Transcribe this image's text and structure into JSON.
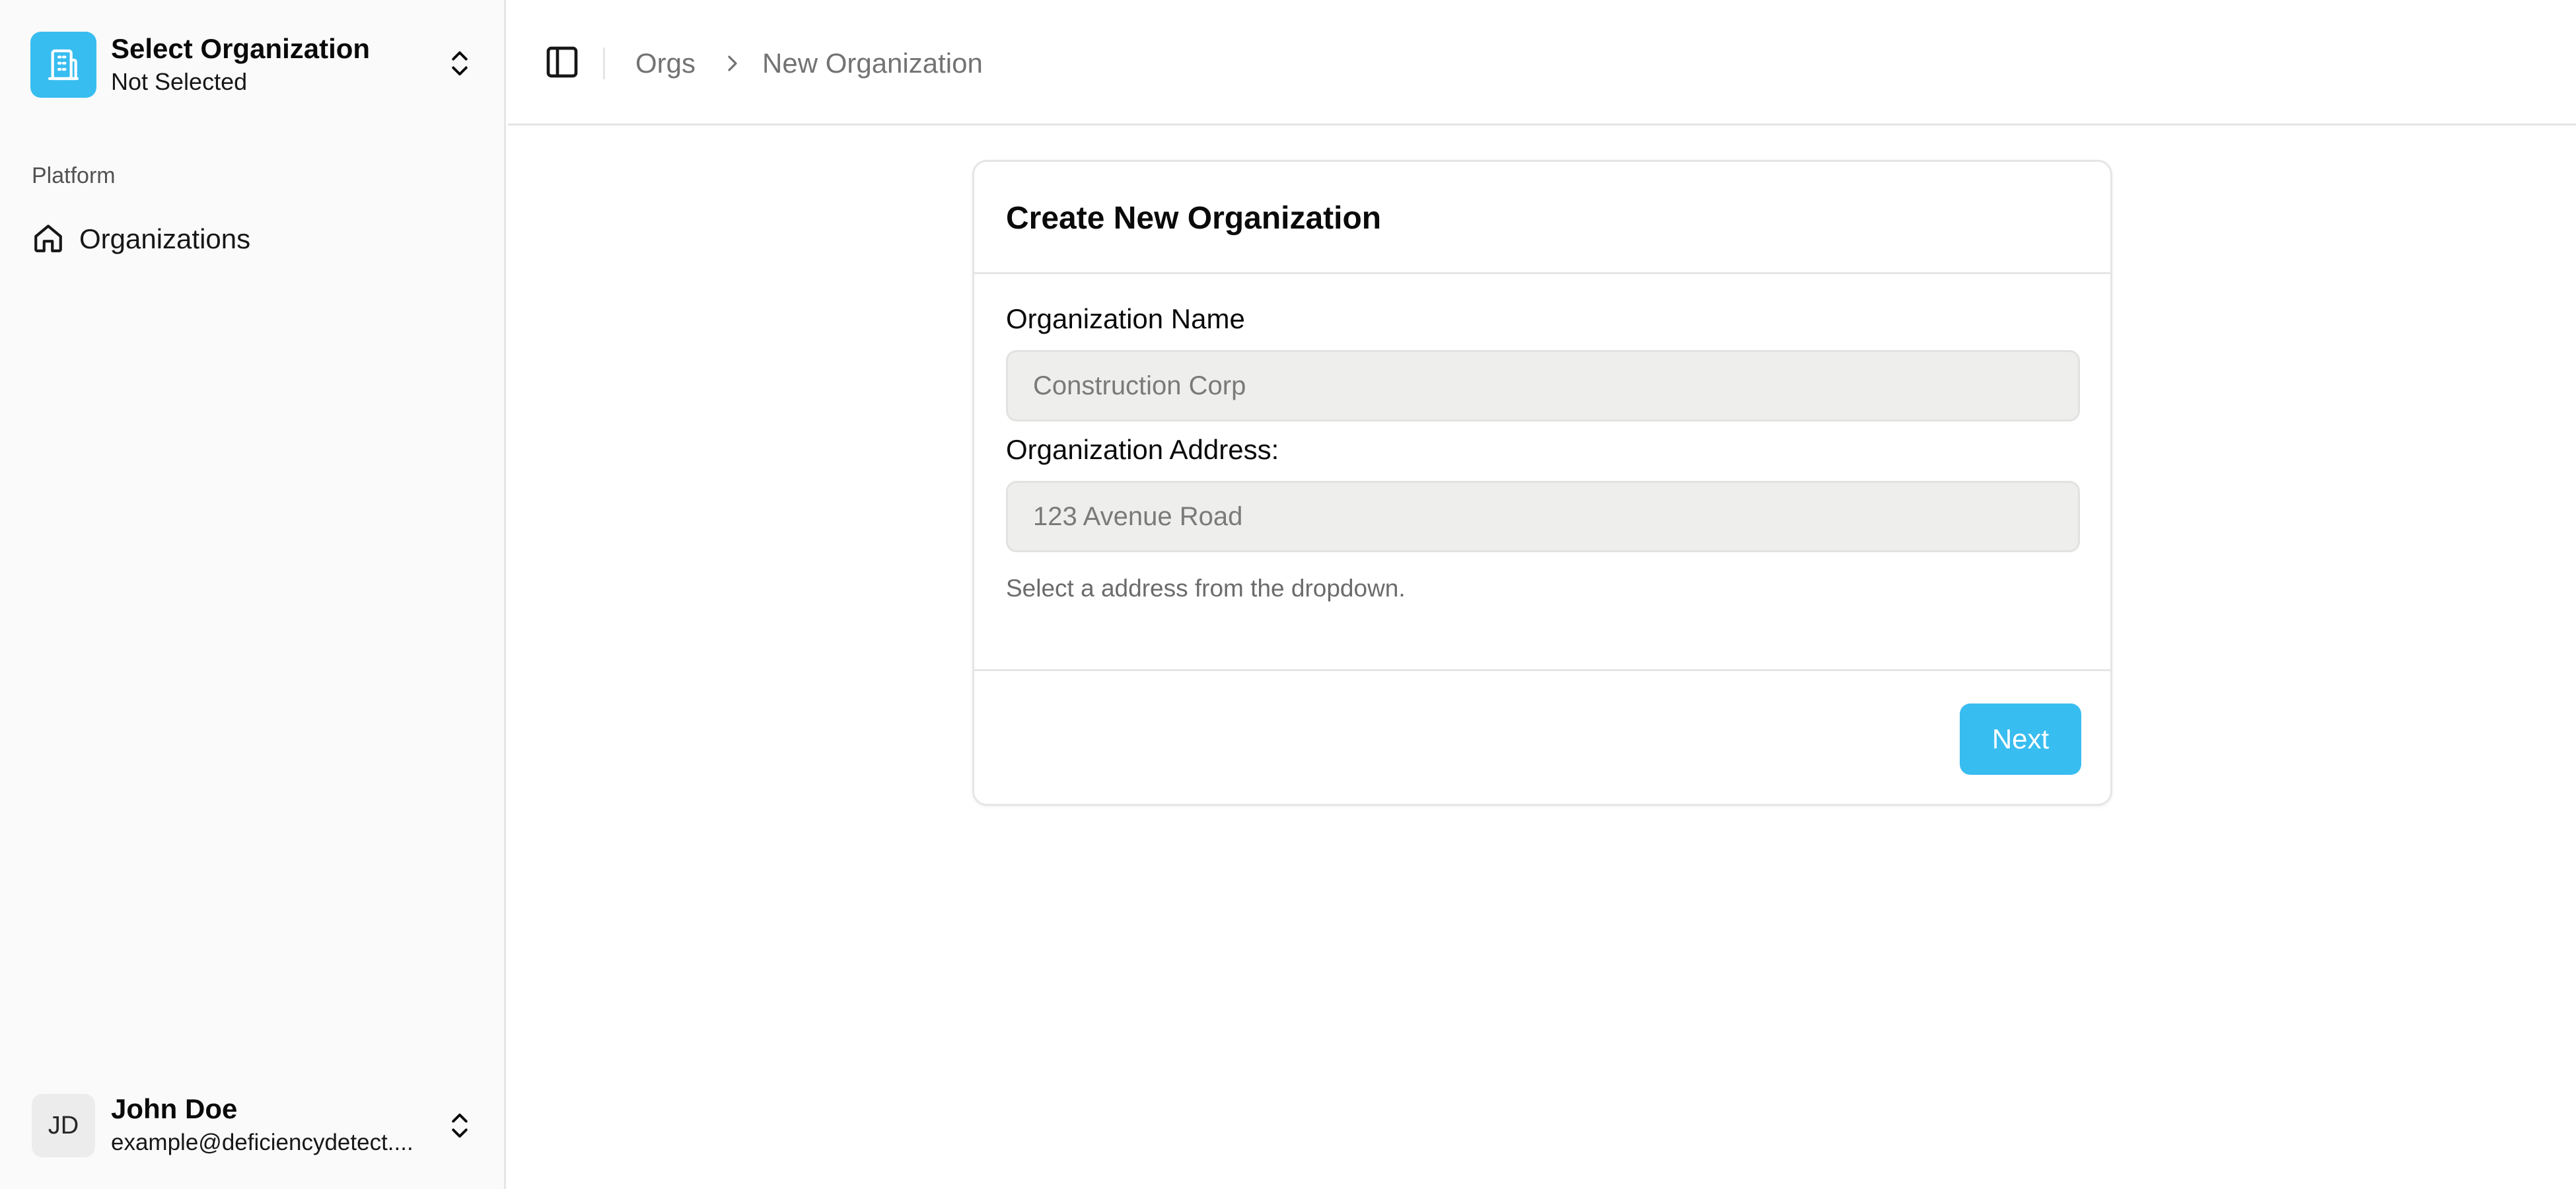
{
  "colors": {
    "accent": "#38bdf0",
    "sidebar_bg": "#fafafa",
    "input_bg": "#eeeeec",
    "border": "#e5e5e5"
  },
  "sidebar": {
    "org_switcher": {
      "title": "Select Organization",
      "subtitle": "Not Selected",
      "logo_icon": "building-icon",
      "toggle_icon": "chevrons-up-down-icon"
    },
    "group_label": "Platform",
    "items": [
      {
        "label": "Organizations",
        "icon": "home-icon"
      }
    ],
    "user": {
      "initials": "JD",
      "name": "John Doe",
      "email": "example@deficiencydetect....",
      "toggle_icon": "chevrons-up-down-icon"
    }
  },
  "header": {
    "toggle_icon": "sidebar-panel-icon",
    "breadcrumb": {
      "items": [
        "Orgs",
        "New Organization"
      ],
      "separator_icon": "chevron-right-icon"
    }
  },
  "card": {
    "title": "Create New Organization",
    "fields": [
      {
        "label": "Organization Name",
        "placeholder": "Construction Corp",
        "value": ""
      },
      {
        "label": "Organization Address:",
        "placeholder": "123 Avenue Road",
        "value": ""
      }
    ],
    "helper_text": "Select a address from the dropdown.",
    "next_label": "Next"
  }
}
